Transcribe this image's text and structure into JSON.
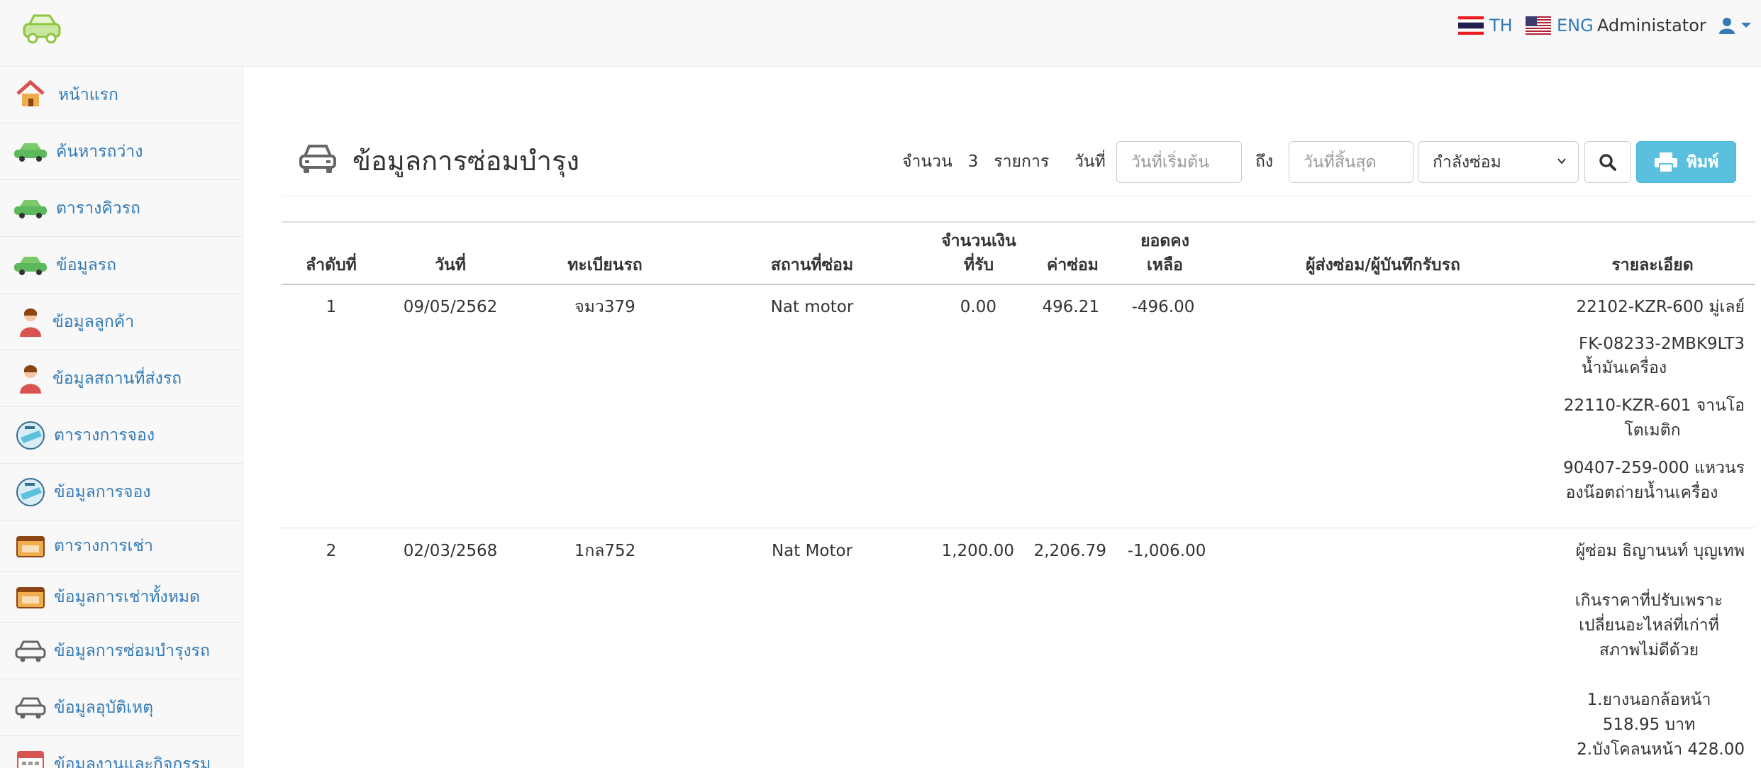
{
  "topbar": {
    "languages": [
      {
        "code": "TH",
        "flag": "thai-flag-icon"
      },
      {
        "code": "ENG",
        "flag": "us-flag-icon"
      }
    ],
    "user_name": "Administator",
    "brand_color": "#8dc63f",
    "link_color": "#337ab7"
  },
  "sidebar": {
    "items": [
      {
        "label": "หน้าแรก",
        "icon": "home-icon"
      },
      {
        "label": "ค้นหารถว่าง",
        "icon": "green-car-icon"
      },
      {
        "label": "ตารางคิวรถ",
        "icon": "green-car-icon"
      },
      {
        "label": "ข้อมูลรถ",
        "icon": "green-car-icon"
      },
      {
        "label": "ข้อมูลลูกค้า",
        "icon": "customer-icon"
      },
      {
        "label": "ข้อมูลสถานที่ส่งรถ",
        "icon": "customer-icon"
      },
      {
        "label": "ตารางการจอง",
        "icon": "booking-icon"
      },
      {
        "label": "ข้อมูลการจอง",
        "icon": "booking-icon"
      },
      {
        "label": "ตารางการเช่า",
        "icon": "rent-icon"
      },
      {
        "label": "ข้อมูลการเช่าทั้งหมด",
        "icon": "rent-icon"
      },
      {
        "label": "ข้อมูลการซ่อมบำรุงรถ",
        "icon": "gray-car-icon"
      },
      {
        "label": "ข้อมูลอุบัติเหตุ",
        "icon": "gray-car-icon"
      },
      {
        "label": "ข้อมูลงานและกิจกรรม",
        "icon": "calendar-icon"
      }
    ]
  },
  "main": {
    "title": "ข้อมูลการซ่อมบำรุง",
    "count": {
      "prefix": "จำนวน",
      "value": "3",
      "suffix": "รายการ"
    },
    "filters": {
      "date_label": "วันที่",
      "start_placeholder": "วันที่เริ่มต้น",
      "to_label": "ถึง",
      "end_placeholder": "วันที่สิ้นสุด",
      "status_selected": "กำลังซ่อม"
    },
    "print_label": "พิมพ์"
  },
  "table": {
    "headers": {
      "no": "ลำดับที่",
      "date": "วันที่",
      "plate": "ทะเบียนรถ",
      "place": "สถานที่ซ่อม",
      "received_1": "จำนวนเงิน",
      "received_2": "ที่รับ",
      "cost": "ค่าซ่อม",
      "balance_1": "ยอดคง",
      "balance_2": "เหลือ",
      "sender": "ผู้ส่งซ่อม/ผู้บันทึกรับรถ",
      "detail": "รายละเอียด"
    },
    "rows": [
      {
        "no": "1",
        "date": "09/05/2562",
        "plate": "จมว379",
        "place": "Nat motor",
        "received": "0.00",
        "cost": "496.21",
        "balance": "-496.00",
        "sender": "",
        "details": [
          "22102-KZR-600 มู่เลย์",
          "FK-08233-2MBK9LT3",
          "น้ำมันเครื่อง",
          "22110-KZR-601 จานโอ",
          "โตเมติก",
          "90407-259-000 แหวนร",
          "องน๊อตถ่ายน้ำนเครื่อง"
        ]
      },
      {
        "no": "2",
        "date": "02/03/2568",
        "plate": "1กล752",
        "place": "Nat Motor",
        "received": "1,200.00",
        "cost": "2,206.79",
        "balance": "-1,006.00",
        "sender": "",
        "details": [
          "ผู้ซ่อม ธิญานนท์ บุญเทพ",
          "เกินราคาที่ปรับเพราะ",
          "เปลี่ยนอะไหล่ที่เก่าที่",
          "สภาพไม่ดีด้วย",
          "1.ยางนอกล้อหน้า",
          "518.95 บาท",
          "2.บังโคลนหน้า 428.00"
        ]
      }
    ]
  }
}
